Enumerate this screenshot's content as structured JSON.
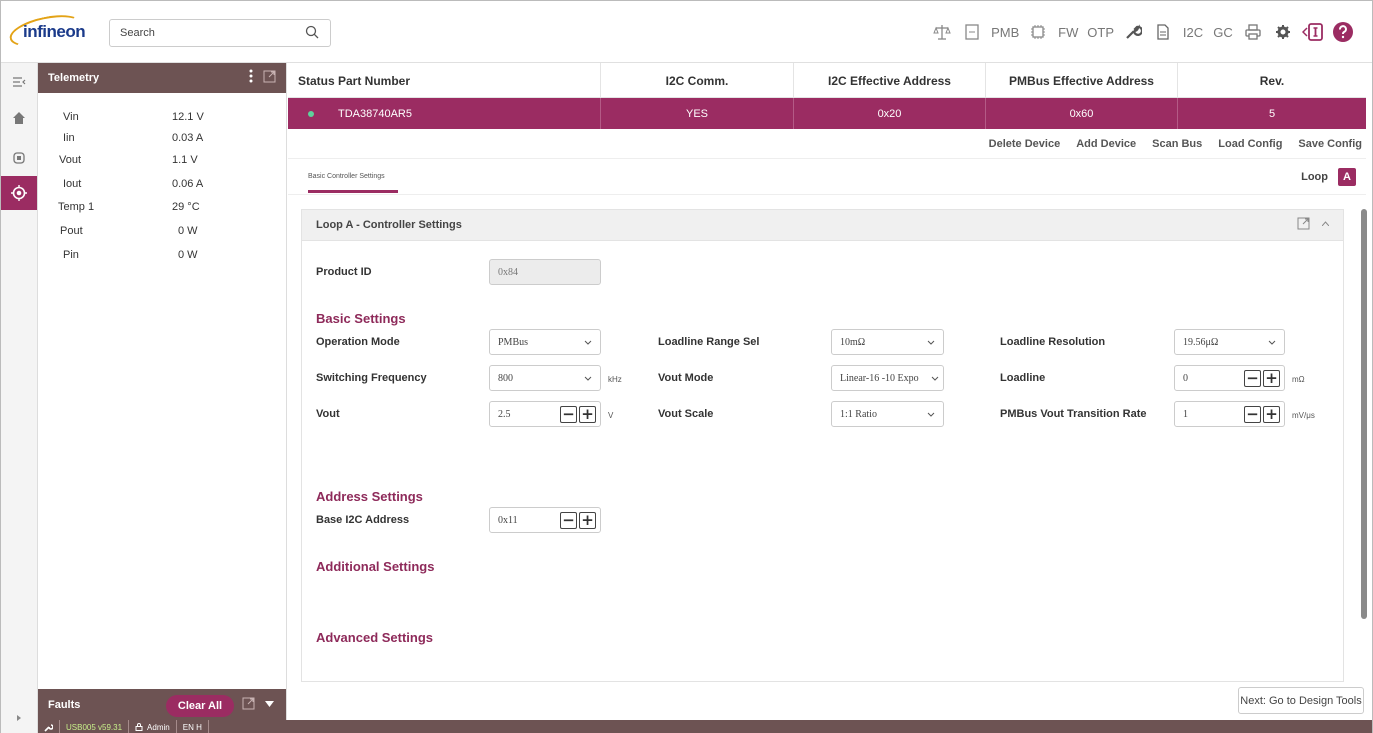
{
  "topbar": {
    "logo_text": "infineon",
    "search_placeholder": "Search",
    "toolbar": [
      {
        "name": "balance-icon",
        "label": ""
      },
      {
        "name": "register-icon",
        "label": ""
      },
      {
        "name": "pmb-label",
        "label": "PMB"
      },
      {
        "name": "chip-icon",
        "label": ""
      },
      {
        "name": "fw-label",
        "label": "FW"
      },
      {
        "name": "otp-label",
        "label": "OTP"
      },
      {
        "name": "wrench-icon",
        "label": ""
      },
      {
        "name": "document-icon",
        "label": ""
      },
      {
        "name": "i2c-label",
        "label": "I2C"
      },
      {
        "name": "gc-label",
        "label": "GC"
      },
      {
        "name": "printer-icon",
        "label": ""
      },
      {
        "name": "gear-icon",
        "label": ""
      },
      {
        "name": "info-panel-icon",
        "label": ""
      },
      {
        "name": "help-icon",
        "label": ""
      }
    ]
  },
  "telemetry": {
    "title": "Telemetry",
    "rows": [
      {
        "label": "Vin",
        "value": "12.1 V"
      },
      {
        "label": "Iin",
        "value": "0.03 A"
      },
      {
        "label": "Vout",
        "value": "1.1 V"
      },
      {
        "label": "Iout",
        "value": "0.06 A"
      },
      {
        "label": "Temp 1",
        "value": "29 °C"
      },
      {
        "label": "Pout",
        "value": "0 W"
      },
      {
        "label": "Pin",
        "value": "0 W"
      }
    ]
  },
  "faults": {
    "title": "Faults",
    "clear_label": "Clear All"
  },
  "statusbar": {
    "usb": "USB005 v59.31",
    "user": "Admin",
    "lang": "EN H"
  },
  "table": {
    "headers": {
      "status": "Status",
      "part": "Part Number",
      "i2c": "I2C Comm.",
      "i2c_addr": "I2C Effective Address",
      "pmbus_addr": "PMBus Effective Address",
      "rev": "Rev."
    },
    "row": {
      "part": "TDA38740AR5",
      "i2c": "YES",
      "i2c_addr": "0x20",
      "pmbus_addr": "0x60",
      "rev": "5"
    }
  },
  "actions": {
    "delete": "Delete Device",
    "add": "Add Device",
    "scan": "Scan Bus",
    "load": "Load Config",
    "save": "Save Config"
  },
  "tabs": {
    "basic": "Basic Controller Settings",
    "loop_label": "Loop",
    "loop_value": "A"
  },
  "settings": {
    "title": "Loop A - Controller Settings",
    "product_id_label": "Product ID",
    "product_id_value": "0x84",
    "basic_title": "Basic Settings",
    "operation_mode_label": "Operation Mode",
    "operation_mode_value": "PMBus",
    "loadline_range_label": "Loadline Range Sel",
    "loadline_range_value": "10mΩ",
    "loadline_resolution_label": "Loadline Resolution",
    "loadline_resolution_value": "19.56μΩ",
    "switching_freq_label": "Switching Frequency",
    "switching_freq_value": "800",
    "switching_freq_unit": "kHz",
    "vout_mode_label": "Vout Mode",
    "vout_mode_value": "Linear-16 -10 Expo",
    "loadline_label": "Loadline",
    "loadline_value": "0",
    "loadline_unit": "mΩ",
    "vout_label": "Vout",
    "vout_value": "2.5",
    "vout_unit": "V",
    "vout_scale_label": "Vout Scale",
    "vout_scale_value": "1:1 Ratio",
    "transition_rate_label": "PMBus Vout Transition Rate",
    "transition_rate_value": "1",
    "transition_rate_unit": "mV/μs",
    "address_title": "Address Settings",
    "base_i2c_label": "Base I2C Address",
    "base_i2c_value": "0x11",
    "additional_title": "Additional Settings",
    "advanced_title": "Advanced Settings"
  },
  "next_button": "Next: Go to Design Tools",
  "colors": {
    "accent": "#9b2c62",
    "panel_header": "#6d5353",
    "status_ok": "#5ed29b"
  }
}
